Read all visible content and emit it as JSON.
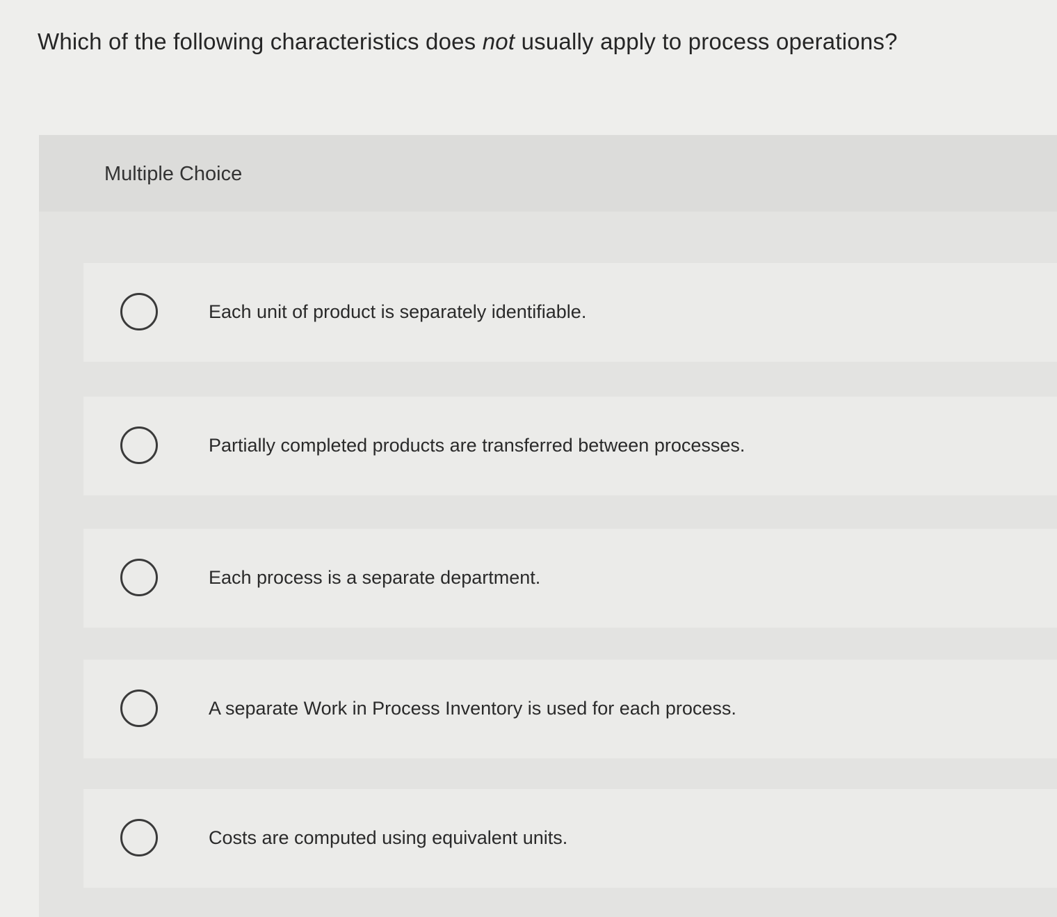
{
  "question": {
    "before": "Which of the following characteristics does ",
    "emphasis": "not",
    "after": " usually apply to process operations?"
  },
  "panel": {
    "title": "Multiple Choice"
  },
  "options": [
    {
      "label": "Each unit of product is separately identifiable.",
      "selected": false
    },
    {
      "label": "Partially completed products are transferred between processes.",
      "selected": false
    },
    {
      "label": "Each process is a separate department.",
      "selected": false
    },
    {
      "label": "A separate Work in Process Inventory is used for each process.",
      "selected": false
    },
    {
      "label": "Costs are computed using equivalent units.",
      "selected": false
    }
  ]
}
